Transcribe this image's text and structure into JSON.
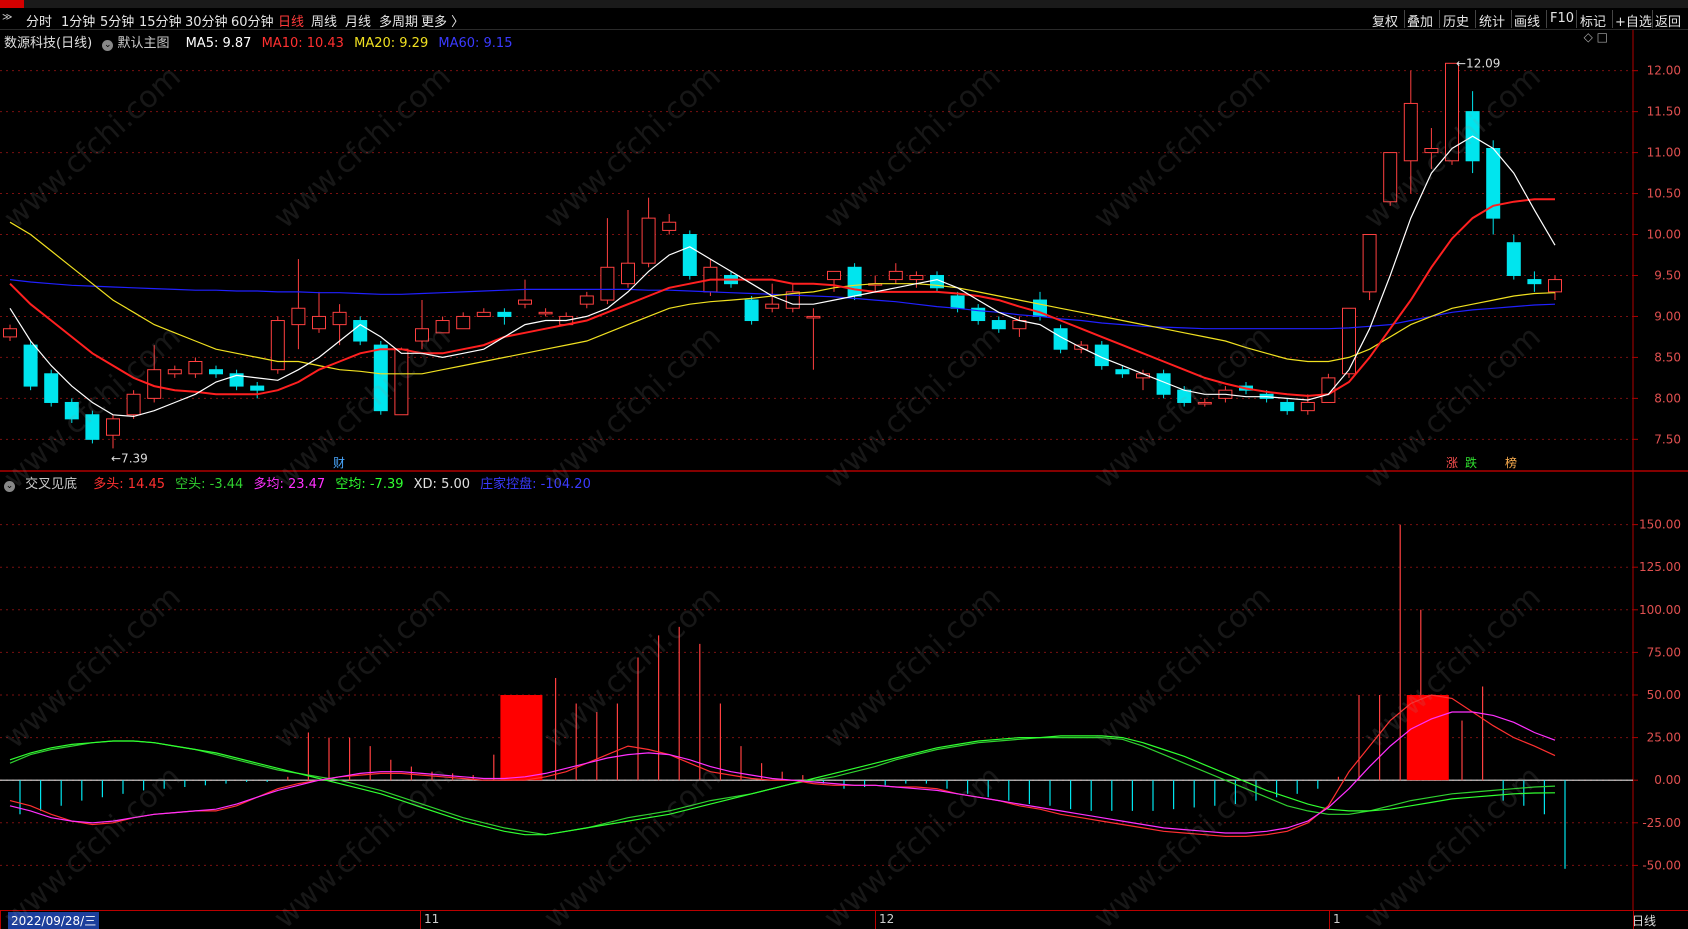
{
  "toolbar": {
    "collapse_glyph": "≫",
    "periods": [
      "分时",
      "1分钟",
      "5分钟",
      "15分钟",
      "30分钟",
      "60分钟",
      "日线",
      "周线",
      "月线",
      "多周期",
      "更多 〉"
    ],
    "active_period": "日线",
    "tools": [
      "复权",
      "叠加",
      "历史",
      "统计",
      "画线",
      "F10",
      "标记",
      "+自选",
      "返回"
    ]
  },
  "main_legend": {
    "stock": "数源科技(日线)",
    "template": "默认主图",
    "ma5": "MA5: 9.87",
    "ma10": "MA10: 10.43",
    "ma20": "MA20: 9.29",
    "ma60": "MA60: 9.15",
    "icons": "◇ □"
  },
  "sub_legend": {
    "name": "交叉见底",
    "duotou": "多头: 14.45",
    "kongtou": "空头: -3.44",
    "duojun": "多均: 23.47",
    "kongjun": "空均: -7.39",
    "xd": "XD: 5.00",
    "zhuli": "庄家控盘: -104.20"
  },
  "colors": {
    "up": "#ff4040",
    "down": "#00e5ee",
    "ma5": "#ffffff",
    "ma10": "#ff2020",
    "ma20": "#f0e020",
    "ma60": "#2020ff",
    "duotou": "#ff3030",
    "kongtou": "#30d030",
    "duojun": "#ff30ff",
    "kongjun": "#30ff30",
    "axis": "#b00000",
    "grid": "#7a1010"
  },
  "markers": {
    "high": "12.09",
    "low": "7.39",
    "fin": "财",
    "zhang": "涨",
    "die": "跌",
    "bang": "榜"
  },
  "date_bar": {
    "selected_date": "2022/09/28/三",
    "months": [
      "11",
      "12",
      "1"
    ],
    "period": "日线"
  },
  "watermark": "www.cfchi.com",
  "chart_data": [
    {
      "type": "candlestick",
      "title": "数源科技(日线)",
      "y_ticks": [
        12.0,
        11.5,
        11.0,
        10.5,
        10.0,
        9.5,
        9.0,
        8.5,
        8.0,
        7.5
      ],
      "ylim": [
        7.15,
        12.35
      ],
      "candles": [
        [
          8.75,
          8.85,
          8.7,
          8.9
        ],
        [
          8.65,
          8.15,
          8.1,
          8.7
        ],
        [
          8.3,
          7.95,
          7.9,
          8.35
        ],
        [
          7.95,
          7.75,
          7.7,
          8.0
        ],
        [
          7.8,
          7.5,
          7.45,
          7.85
        ],
        [
          7.55,
          7.75,
          7.39,
          7.8
        ],
        [
          7.8,
          8.05,
          7.75,
          8.1
        ],
        [
          8.0,
          8.35,
          7.95,
          8.65
        ],
        [
          8.3,
          8.35,
          8.25,
          8.4
        ],
        [
          8.3,
          8.45,
          8.25,
          8.5
        ],
        [
          8.35,
          8.3,
          8.25,
          8.4
        ],
        [
          8.3,
          8.15,
          8.1,
          8.35
        ],
        [
          8.15,
          8.1,
          8.0,
          8.2
        ],
        [
          8.35,
          8.95,
          8.3,
          9.0
        ],
        [
          8.9,
          9.1,
          8.6,
          9.7
        ],
        [
          8.85,
          9.0,
          8.8,
          9.3
        ],
        [
          8.9,
          9.05,
          8.65,
          9.15
        ],
        [
          8.95,
          8.7,
          8.65,
          9.0
        ],
        [
          8.65,
          7.85,
          7.8,
          8.7
        ],
        [
          7.8,
          8.6,
          7.8,
          8.62
        ],
        [
          8.7,
          8.85,
          8.6,
          9.2
        ],
        [
          8.8,
          8.95,
          8.8,
          9.0
        ],
        [
          8.85,
          9.0,
          8.85,
          9.05
        ],
        [
          9.0,
          9.05,
          9.0,
          9.1
        ],
        [
          9.05,
          9.0,
          8.9,
          9.1
        ],
        [
          9.15,
          9.2,
          9.1,
          9.45
        ],
        [
          9.05,
          9.05,
          9.0,
          9.1
        ],
        [
          8.9,
          9.0,
          8.9,
          9.05
        ],
        [
          9.15,
          9.25,
          9.1,
          9.3
        ],
        [
          9.2,
          9.6,
          9.15,
          10.2
        ],
        [
          9.4,
          9.65,
          9.35,
          10.3
        ],
        [
          9.65,
          10.2,
          9.6,
          10.45
        ],
        [
          10.05,
          10.15,
          10.0,
          10.25
        ],
        [
          10.0,
          9.5,
          9.45,
          10.05
        ],
        [
          9.3,
          9.6,
          9.25,
          9.7
        ],
        [
          9.5,
          9.4,
          9.35,
          9.55
        ],
        [
          9.2,
          8.95,
          8.9,
          9.25
        ],
        [
          9.1,
          9.15,
          9.05,
          9.4
        ],
        [
          9.1,
          9.3,
          9.05,
          9.4
        ],
        [
          9.0,
          9.0,
          8.35,
          9.1
        ],
        [
          9.45,
          9.55,
          9.3,
          9.55
        ],
        [
          9.6,
          9.25,
          9.2,
          9.65
        ],
        [
          9.4,
          9.4,
          9.3,
          9.5
        ],
        [
          9.45,
          9.55,
          9.4,
          9.65
        ],
        [
          9.45,
          9.5,
          9.35,
          9.55
        ],
        [
          9.5,
          9.35,
          9.3,
          9.55
        ],
        [
          9.25,
          9.1,
          9.05,
          9.3
        ],
        [
          9.1,
          8.95,
          8.9,
          9.15
        ],
        [
          8.95,
          8.85,
          8.8,
          9.0
        ],
        [
          8.85,
          8.95,
          8.75,
          9.0
        ],
        [
          9.2,
          9.0,
          8.95,
          9.3
        ],
        [
          8.85,
          8.6,
          8.55,
          8.9
        ],
        [
          8.6,
          8.65,
          8.55,
          8.7
        ],
        [
          8.65,
          8.4,
          8.35,
          8.7
        ],
        [
          8.35,
          8.3,
          8.25,
          8.4
        ],
        [
          8.25,
          8.3,
          8.1,
          8.35
        ],
        [
          8.3,
          8.05,
          8.0,
          8.35
        ],
        [
          8.1,
          7.95,
          7.9,
          8.15
        ],
        [
          7.95,
          7.95,
          7.9,
          8.0
        ],
        [
          8.0,
          8.1,
          7.95,
          8.15
        ],
        [
          8.15,
          8.1,
          8.05,
          8.2
        ],
        [
          8.05,
          8.0,
          7.95,
          8.1
        ],
        [
          7.95,
          7.85,
          7.8,
          8.0
        ],
        [
          7.85,
          7.95,
          7.8,
          8.05
        ],
        [
          7.95,
          8.25,
          7.95,
          8.3
        ],
        [
          8.3,
          9.1,
          8.25,
          9.1
        ],
        [
          9.3,
          10.0,
          9.2,
          10.0
        ],
        [
          10.4,
          11.0,
          10.35,
          11.0
        ],
        [
          10.9,
          11.6,
          10.5,
          12.0
        ],
        [
          11.0,
          11.05,
          10.8,
          11.3
        ],
        [
          10.9,
          12.09,
          10.85,
          12.09
        ],
        [
          11.5,
          10.9,
          10.75,
          11.75
        ],
        [
          11.05,
          10.2,
          10.0,
          11.15
        ],
        [
          9.9,
          9.5,
          9.45,
          10.0
        ],
        [
          9.45,
          9.4,
          9.3,
          9.55
        ],
        [
          9.3,
          9.45,
          9.2,
          9.5
        ]
      ],
      "ma5": [
        9.1,
        8.7,
        8.4,
        8.15,
        7.95,
        7.8,
        7.78,
        7.85,
        7.95,
        8.05,
        8.2,
        8.28,
        8.25,
        8.22,
        8.35,
        8.5,
        8.7,
        8.9,
        8.75,
        8.55,
        8.55,
        8.5,
        8.55,
        8.6,
        8.75,
        8.9,
        8.95,
        8.95,
        9.0,
        9.1,
        9.3,
        9.55,
        9.75,
        9.85,
        9.7,
        9.55,
        9.4,
        9.25,
        9.15,
        9.15,
        9.2,
        9.25,
        9.3,
        9.35,
        9.4,
        9.45,
        9.35,
        9.2,
        9.05,
        8.95,
        8.9,
        8.75,
        8.62,
        8.5,
        8.4,
        8.3,
        8.2,
        8.1,
        8.05,
        8.05,
        8.02,
        8.02,
        8.0,
        7.98,
        8.05,
        8.35,
        8.85,
        9.5,
        10.2,
        10.75,
        11.05,
        11.2,
        11.05,
        10.75,
        10.3,
        9.87
      ],
      "ma10": [
        9.4,
        9.15,
        8.95,
        8.75,
        8.55,
        8.4,
        8.25,
        8.15,
        8.1,
        8.08,
        8.05,
        8.05,
        8.05,
        8.1,
        8.2,
        8.35,
        8.45,
        8.55,
        8.6,
        8.6,
        8.55,
        8.55,
        8.6,
        8.65,
        8.75,
        8.8,
        8.85,
        8.9,
        8.95,
        9.05,
        9.15,
        9.25,
        9.35,
        9.4,
        9.45,
        9.45,
        9.45,
        9.45,
        9.4,
        9.4,
        9.38,
        9.33,
        9.3,
        9.3,
        9.3,
        9.3,
        9.28,
        9.25,
        9.2,
        9.12,
        9.05,
        8.95,
        8.85,
        8.75,
        8.65,
        8.55,
        8.45,
        8.35,
        8.25,
        8.18,
        8.12,
        8.08,
        8.05,
        8.03,
        8.05,
        8.2,
        8.5,
        8.85,
        9.2,
        9.6,
        9.95,
        10.2,
        10.35,
        10.4,
        10.43,
        10.43
      ],
      "ma20": [
        10.15,
        10.0,
        9.8,
        9.6,
        9.4,
        9.2,
        9.05,
        8.9,
        8.8,
        8.7,
        8.6,
        8.55,
        8.5,
        8.45,
        8.45,
        8.4,
        8.35,
        8.33,
        8.3,
        8.3,
        8.3,
        8.35,
        8.4,
        8.45,
        8.5,
        8.55,
        8.6,
        8.65,
        8.7,
        8.8,
        8.9,
        9.0,
        9.1,
        9.15,
        9.18,
        9.2,
        9.22,
        9.25,
        9.28,
        9.3,
        9.35,
        9.38,
        9.4,
        9.4,
        9.4,
        9.38,
        9.35,
        9.3,
        9.25,
        9.2,
        9.15,
        9.1,
        9.05,
        9.0,
        8.95,
        8.9,
        8.85,
        8.8,
        8.75,
        8.7,
        8.62,
        8.55,
        8.48,
        8.45,
        8.45,
        8.5,
        8.6,
        8.75,
        8.9,
        9.0,
        9.1,
        9.15,
        9.2,
        9.25,
        9.28,
        9.29
      ],
      "ma60": [
        9.45,
        9.42,
        9.4,
        9.38,
        9.37,
        9.36,
        9.35,
        9.34,
        9.33,
        9.32,
        9.32,
        9.31,
        9.31,
        9.3,
        9.3,
        9.29,
        9.29,
        9.28,
        9.27,
        9.27,
        9.28,
        9.29,
        9.3,
        9.31,
        9.32,
        9.33,
        9.33,
        9.33,
        9.33,
        9.33,
        9.33,
        9.32,
        9.32,
        9.31,
        9.3,
        9.29,
        9.28,
        9.27,
        9.26,
        9.25,
        9.24,
        9.22,
        9.2,
        9.18,
        9.15,
        9.12,
        9.1,
        9.07,
        9.05,
        9.02,
        9.0,
        8.97,
        8.95,
        8.92,
        8.9,
        8.88,
        8.87,
        8.86,
        8.85,
        8.85,
        8.85,
        8.85,
        8.85,
        8.85,
        8.85,
        8.86,
        8.88,
        8.9,
        8.95,
        9.0,
        9.05,
        9.08,
        9.1,
        9.12,
        9.14,
        9.15
      ]
    },
    {
      "type": "indicator",
      "title": "交叉见底",
      "y_ticks": [
        150.0,
        125.0,
        100.0,
        75.0,
        50.0,
        25.0,
        0.0,
        -25.0,
        -50.0
      ],
      "ylim": [
        -75,
        175
      ],
      "bars": [
        -20,
        -18,
        -15,
        -12,
        -10,
        -8,
        -6,
        -5,
        -4,
        -3,
        -2,
        -1,
        -1,
        2,
        28,
        25,
        25,
        20,
        12,
        8,
        5,
        4,
        3,
        15,
        50,
        45,
        60,
        45,
        40,
        45,
        72,
        85,
        90,
        80,
        45,
        20,
        10,
        5,
        3,
        -2,
        -5,
        -4,
        -3,
        -2,
        -2,
        -5,
        -8,
        -10,
        -12,
        -14,
        -15,
        -17,
        -18,
        -18,
        -18,
        -18,
        -17,
        -16,
        -15,
        -14,
        -12,
        -10,
        -8,
        -5,
        2,
        50,
        50,
        150,
        100,
        40,
        35,
        55,
        -12,
        -15,
        -20,
        -52
      ],
      "big_red_blocks": [
        24,
        68
      ],
      "duotou": [
        -12,
        -15,
        -20,
        -24,
        -26,
        -25,
        -22,
        -20,
        -19,
        -18,
        -18,
        -15,
        -10,
        -5,
        -2,
        0,
        2,
        3,
        4,
        4,
        3,
        2,
        1,
        0,
        0,
        0,
        2,
        5,
        10,
        15,
        20,
        18,
        15,
        10,
        5,
        3,
        1,
        0,
        0,
        -2,
        -3,
        -3,
        -3,
        -4,
        -4,
        -5,
        -8,
        -10,
        -12,
        -15,
        -17,
        -20,
        -22,
        -24,
        -26,
        -28,
        -30,
        -31,
        -32,
        -33,
        -33,
        -32,
        -30,
        -25,
        -15,
        5,
        20,
        35,
        45,
        50,
        48,
        40,
        32,
        25,
        20,
        14.45
      ],
      "kongtou": [
        10,
        15,
        18,
        20,
        22,
        23,
        23,
        22,
        20,
        18,
        15,
        12,
        9,
        6,
        4,
        2,
        0,
        -3,
        -6,
        -10,
        -14,
        -18,
        -22,
        -25,
        -28,
        -30,
        -32,
        -30,
        -28,
        -25,
        -22,
        -20,
        -18,
        -15,
        -12,
        -10,
        -8,
        -5,
        -2,
        0,
        2,
        5,
        8,
        12,
        15,
        18,
        20,
        22,
        23,
        24,
        25,
        25,
        25,
        25,
        24,
        20,
        15,
        10,
        5,
        0,
        -5,
        -10,
        -15,
        -18,
        -20,
        -20,
        -18,
        -15,
        -12,
        -10,
        -8,
        -7,
        -6,
        -5,
        -4,
        -3.44
      ],
      "duojun": [
        -15,
        -18,
        -22,
        -24,
        -25,
        -24,
        -22,
        -20,
        -19,
        -18,
        -17,
        -14,
        -10,
        -6,
        -3,
        0,
        2,
        4,
        5,
        5,
        4,
        3,
        2,
        1,
        1,
        2,
        4,
        7,
        10,
        13,
        15,
        16,
        15,
        12,
        8,
        5,
        3,
        1,
        0,
        -1,
        -2,
        -3,
        -3,
        -4,
        -5,
        -6,
        -8,
        -10,
        -12,
        -14,
        -16,
        -18,
        -20,
        -22,
        -24,
        -26,
        -28,
        -29,
        -30,
        -31,
        -31,
        -30,
        -28,
        -24,
        -16,
        -5,
        8,
        20,
        30,
        36,
        40,
        40,
        38,
        34,
        28,
        23.47
      ],
      "kongjun": [
        12,
        16,
        19,
        21,
        22,
        23,
        23,
        22,
        20,
        18,
        16,
        13,
        10,
        7,
        4,
        1,
        -2,
        -5,
        -8,
        -12,
        -16,
        -20,
        -24,
        -27,
        -30,
        -32,
        -32,
        -30,
        -28,
        -26,
        -24,
        -22,
        -20,
        -17,
        -14,
        -11,
        -8,
        -5,
        -2,
        1,
        4,
        7,
        10,
        13,
        16,
        19,
        21,
        23,
        24,
        25,
        25,
        26,
        26,
        26,
        25,
        22,
        18,
        14,
        9,
        4,
        -1,
        -6,
        -10,
        -14,
        -17,
        -18,
        -18,
        -17,
        -15,
        -13,
        -11,
        -10,
        -9,
        -8,
        -7.5,
        -7.39
      ]
    }
  ]
}
